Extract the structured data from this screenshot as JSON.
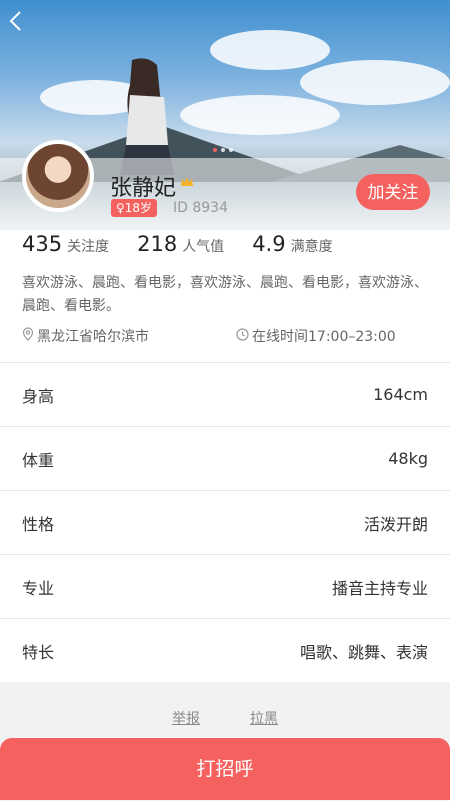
{
  "header": {
    "back_icon": "back-arrow-icon"
  },
  "profile": {
    "name": "张静妃",
    "crown_icon": "crown-icon",
    "age": "♀18岁",
    "id": "ID 8934",
    "follow_label": "加关注"
  },
  "stats": [
    {
      "num": "435",
      "label": "关注度"
    },
    {
      "num": "218",
      "label": "人气值"
    },
    {
      "num": "4.9",
      "label": "满意度"
    }
  ],
  "hobby": "喜欢游泳、晨跑、看电影，喜欢游泳、晨跑、看电影，喜欢游泳、晨跑、看电影。",
  "location": "黑龙江省哈尔滨市",
  "online": "在线时间17:00–23:00",
  "details": [
    {
      "key": "身高",
      "value": "164cm"
    },
    {
      "key": "体重",
      "value": "48kg"
    },
    {
      "key": "性格",
      "value": "活泼开朗"
    },
    {
      "key": "专业",
      "value": "播音主持专业"
    },
    {
      "key": "特长",
      "value": "唱歌、跳舞、表演"
    }
  ],
  "footer": {
    "report": "举报",
    "block": "拉黑"
  },
  "greet_label": "打招呼",
  "colors": {
    "accent": "#f5615f"
  }
}
